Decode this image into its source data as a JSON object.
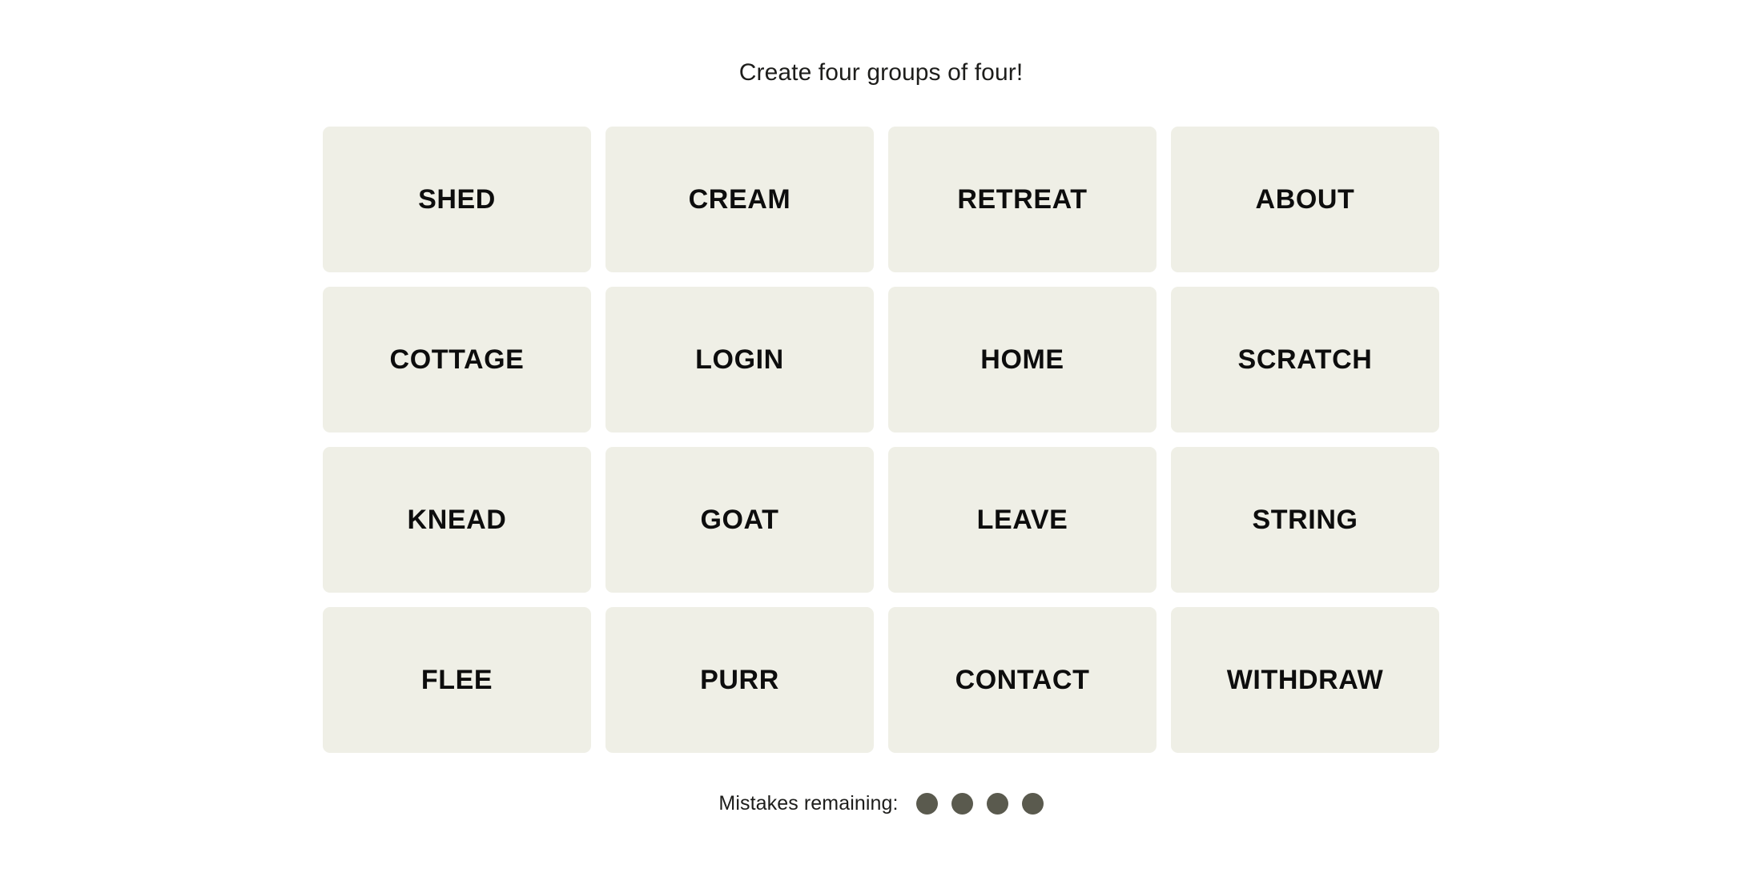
{
  "game": {
    "instruction": "Create four groups of four!",
    "tiles": [
      {
        "label": "SHED"
      },
      {
        "label": "CREAM"
      },
      {
        "label": "RETREAT"
      },
      {
        "label": "ABOUT"
      },
      {
        "label": "COTTAGE"
      },
      {
        "label": "LOGIN"
      },
      {
        "label": "HOME"
      },
      {
        "label": "SCRATCH"
      },
      {
        "label": "KNEAD"
      },
      {
        "label": "GOAT"
      },
      {
        "label": "LEAVE"
      },
      {
        "label": "STRING"
      },
      {
        "label": "FLEE"
      },
      {
        "label": "PURR"
      },
      {
        "label": "CONTACT"
      },
      {
        "label": "WITHDRAW"
      }
    ],
    "mistakes": {
      "label": "Mistakes remaining:",
      "remaining": 4,
      "dots": [
        1,
        2,
        3,
        4
      ]
    },
    "colors": {
      "page_background": "#ffffff",
      "tile_background": "#efefe6",
      "tile_text": "#0d0d0d",
      "body_text": "#1d1d1b",
      "mistake_dot": "#5a5a4e"
    }
  }
}
